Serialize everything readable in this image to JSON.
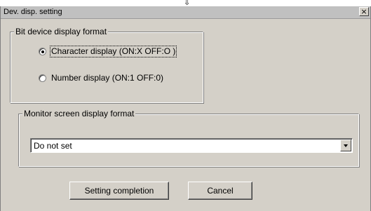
{
  "window": {
    "title": "Dev. disp. setting",
    "close_label": "×"
  },
  "bit_device_group": {
    "legend": "Bit device display format",
    "options": [
      {
        "label": "Character display (ON:X  OFF:O )",
        "selected": true
      },
      {
        "label": "Number display (ON:1  OFF:0)",
        "selected": false
      }
    ]
  },
  "monitor_group": {
    "legend": "Monitor screen display format",
    "select_value": "Do not set"
  },
  "buttons": {
    "ok_label": "Setting completion",
    "cancel_label": "Cancel"
  },
  "pointer_glyph": "⇩",
  "colors": {
    "dialog_bg": "#d4d0c8",
    "titlebar_bg": "#c0c0c0",
    "field_bg": "#ffffff"
  }
}
